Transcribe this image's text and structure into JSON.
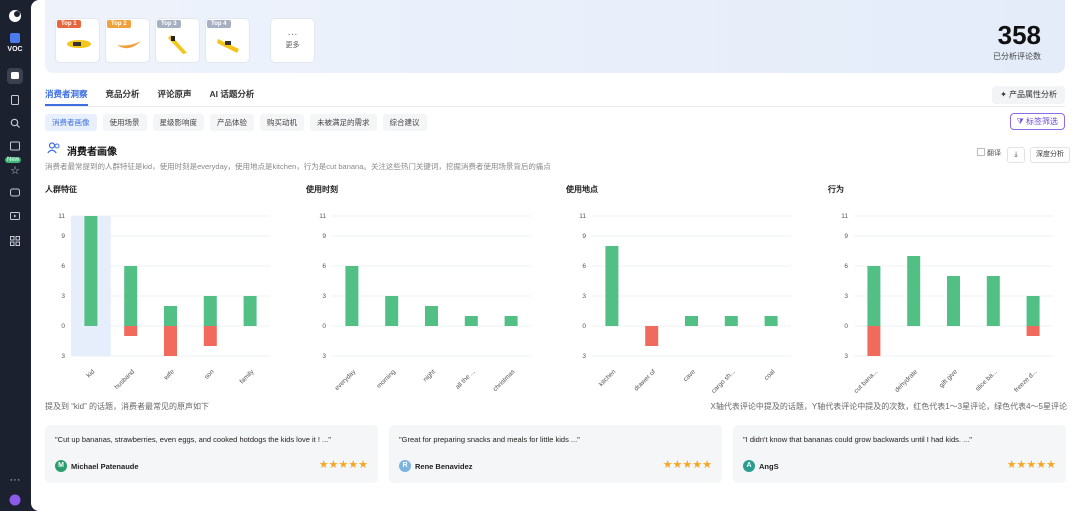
{
  "sidebar": {
    "voc": "VOC",
    "new_badge": "New"
  },
  "banner": {
    "products": [
      {
        "tag": "Top 1",
        "color": "#e8663c"
      },
      {
        "tag": "Top 2",
        "color": "#f0a23a"
      },
      {
        "tag": "Top 3",
        "color": "#a7b0c3"
      },
      {
        "tag": "Top 4",
        "color": "#a7b0c3"
      }
    ],
    "more_label": "更多",
    "review_count": "358",
    "review_count_label": "已分析评论数"
  },
  "tabs": [
    {
      "label": "消费者洞察",
      "active": true
    },
    {
      "label": "竞品分析"
    },
    {
      "label": "评论原声"
    },
    {
      "label": "AI 话题分析"
    }
  ],
  "attr_button": "产品属性分析",
  "subtabs": [
    {
      "label": "消费者画像",
      "active": true
    },
    {
      "label": "使用场景"
    },
    {
      "label": "星级影响度"
    },
    {
      "label": "产品体验"
    },
    {
      "label": "购买动机"
    },
    {
      "label": "未被满足的需求"
    },
    {
      "label": "综合建议"
    }
  ],
  "filter_button": "标签筛选",
  "section": {
    "title": "消费者画像",
    "desc": "消费者最常提到的人群特征是kid，使用时刻是everyday，使用地点是kitchen，行为是cut banana。关注这些热门关键词，挖掘消费者使用场景背后的痛点",
    "translate": "翻译",
    "deep": "深度分析"
  },
  "colors": {
    "positive": "#52c084",
    "negative": "#f06a5e",
    "highlight": "#e6eefc"
  },
  "chart_data": [
    {
      "type": "bar",
      "title": "人群特征",
      "categories": [
        "kid",
        "husband",
        "wife",
        "son",
        "family"
      ],
      "positive": [
        11,
        6,
        2,
        3,
        3
      ],
      "negative": [
        0,
        1,
        3,
        2,
        0
      ],
      "highlight_index": 0,
      "yticks": [
        "11",
        "9",
        "6",
        "3",
        "0",
        "3"
      ]
    },
    {
      "type": "bar",
      "title": "使用时刻",
      "categories": [
        "everyday",
        "morning",
        "night",
        "all the ...",
        "christmas"
      ],
      "positive": [
        6,
        3,
        2,
        1,
        1
      ],
      "negative": [
        0,
        0,
        0,
        0,
        0
      ],
      "yticks": [
        "11",
        "9",
        "6",
        "3",
        "0",
        "3"
      ]
    },
    {
      "type": "bar",
      "title": "使用地点",
      "categories": [
        "kitchen",
        "drawer of",
        "cave",
        "cargo sh...",
        "coal"
      ],
      "positive": [
        8,
        0,
        1,
        1,
        1
      ],
      "negative": [
        0,
        2,
        0,
        0,
        0
      ],
      "yticks": [
        "11",
        "9",
        "6",
        "3",
        "0",
        "3"
      ]
    },
    {
      "type": "bar",
      "title": "行为",
      "categories": [
        "cut bana...",
        "dehydrate",
        "gift give",
        "slice ba...",
        "freeze d..."
      ],
      "positive": [
        6,
        7,
        5,
        5,
        3
      ],
      "negative": [
        3,
        0,
        0,
        0,
        1
      ],
      "yticks": [
        "11",
        "9",
        "6",
        "3",
        "0",
        "3"
      ]
    }
  ],
  "caption_left": "提及到 “kid” 的话题，消费者最常见的原声如下",
  "caption_right": "X轴代表评论中提及的话题，Y轴代表评论中提及的次数，红色代表1～3星评论，绿色代表4～5星评论",
  "reviews": [
    {
      "quote": "\"Cut up bananas, strawberries, even eggs, and cooked hotdogs the kids love it ! ...\"",
      "initial": "M",
      "name": "Michael Patenaude",
      "stars": "★★★★★",
      "avatar_color": "#2a9d6e"
    },
    {
      "quote": "\"Great for preparing snacks and meals for little kids ...\"",
      "initial": "R",
      "name": "Rene Benavidez",
      "stars": "★★★★★",
      "avatar_color": "#7bb5e0"
    },
    {
      "quote": "\"I didn't know that bananas could grow backwards until I had kids. ...\"",
      "initial": "A",
      "name": "AngS",
      "stars": "★★★★★",
      "avatar_color": "#2a9d8f"
    }
  ]
}
